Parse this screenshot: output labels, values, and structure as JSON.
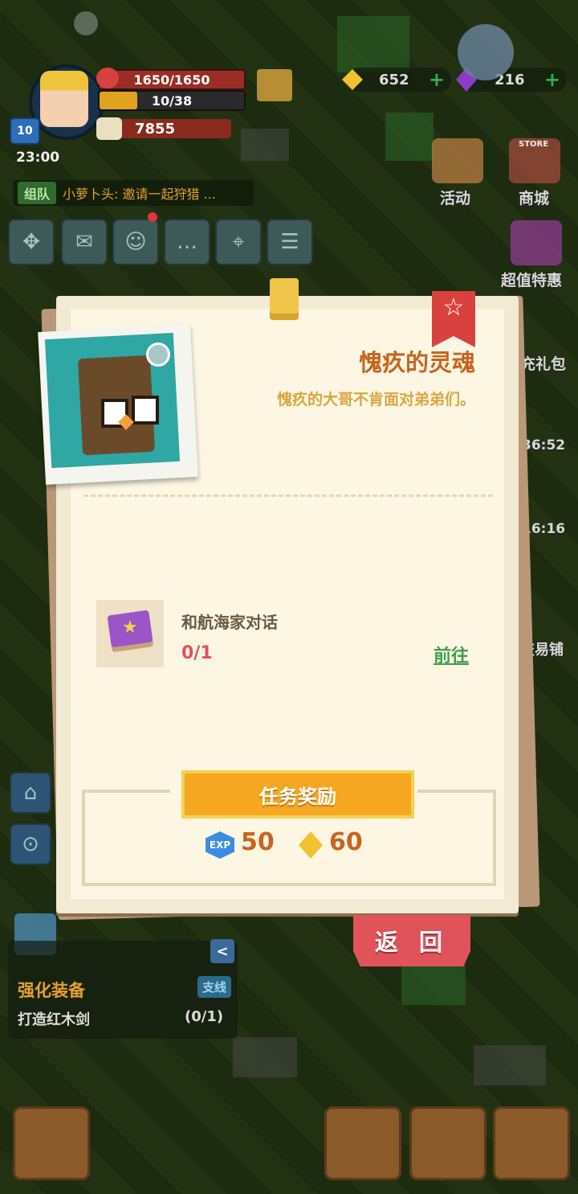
{
  "hud": {
    "level": "10",
    "hp": "1650/1650",
    "energy": "10/38",
    "energy_fraction": 0.263,
    "power": "7855",
    "time": "23:00",
    "gold": "652",
    "gems": "216",
    "chat_channel": "组队",
    "chat_message": "小萝卜头: 邀请一起狩猎 ..."
  },
  "side_menu": {
    "activity": "活动",
    "store": "商城",
    "store_badge": "STORE",
    "deals": "超值特惠",
    "gift_partial": "充礼包",
    "timer1": "36:52",
    "timer2": "16:16",
    "trade_partial": "交易铺"
  },
  "quest_dialog": {
    "title": "愧疚的灵魂",
    "description": "愧疚的大哥不肯面对弟弟们。",
    "task_label": "和航海家对话",
    "task_progress": "0/1",
    "go_label": "前往",
    "reward_header": "任务奖励",
    "exp_badge": "EXP",
    "exp_amount": "50",
    "gold_amount": "60",
    "return_label": "返 回"
  },
  "quest_tracker": {
    "title": "强化装备",
    "tag": "支线",
    "description": "打造红木剑",
    "count": "(0/1)"
  },
  "colors": {
    "accent_orange": "#c8641e",
    "ribbon_red": "#d9413f",
    "reward_gold": "#f5a722",
    "go_green": "#3fa14a"
  }
}
